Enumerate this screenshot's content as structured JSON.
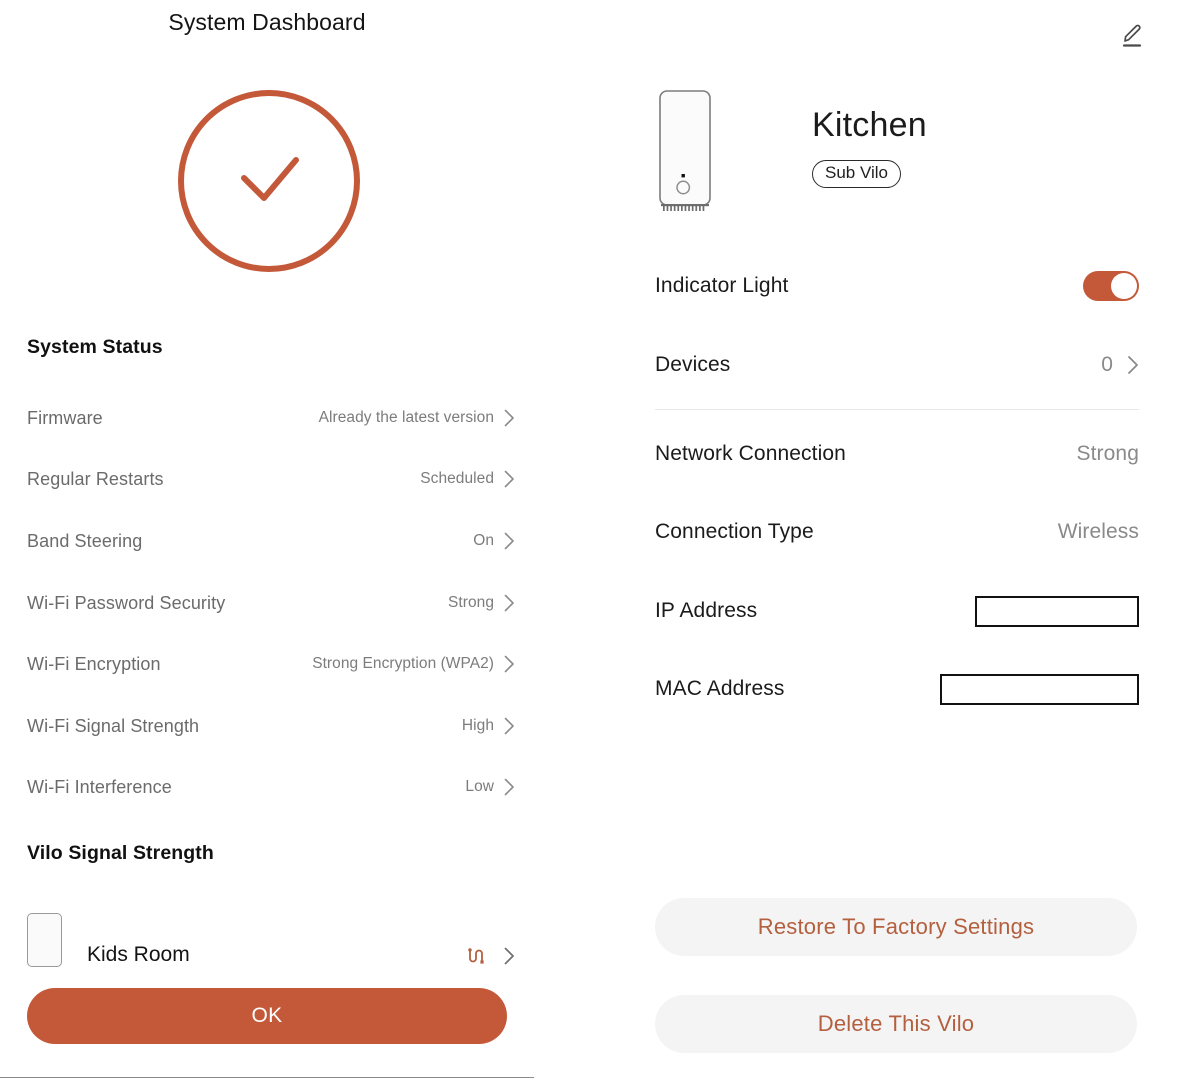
{
  "theme": {
    "accent": "#c4593a",
    "accent_text": "#b4603f",
    "label_gray": "#6b6b6b",
    "value_gray": "#8a8a8a",
    "divider": "#e8e8e8"
  },
  "left": {
    "title": "System Dashboard",
    "status_icon": "check-circle-icon",
    "system_status": {
      "heading": "System Status",
      "rows": [
        {
          "label": "Firmware",
          "value": "Already the latest version"
        },
        {
          "label": "Regular Restarts",
          "value": "Scheduled"
        },
        {
          "label": "Band Steering",
          "value": "On"
        },
        {
          "label": "Wi-Fi Password Security",
          "value": "Strong"
        },
        {
          "label": "Wi-Fi Encryption",
          "value": "Strong Encryption (WPA2)"
        },
        {
          "label": "Wi-Fi Signal Strength",
          "value": "High"
        },
        {
          "label": "Wi-Fi Interference",
          "value": "Low"
        }
      ]
    },
    "vilo_signal": {
      "heading": "Vilo Signal Strength",
      "items": [
        {
          "name": "Kids Room",
          "icon": "mesh-link-icon"
        }
      ]
    },
    "ok_label": "OK"
  },
  "right": {
    "edit_icon": "pencil-edit-icon",
    "device": {
      "name": "Kitchen",
      "badge": "Sub Vilo",
      "image": "vilo-router-icon"
    },
    "indicator_light": {
      "label": "Indicator Light",
      "state": "on"
    },
    "devices": {
      "label": "Devices",
      "value": "0"
    },
    "info_rows": [
      {
        "label": "Network Connection",
        "value": "Strong"
      },
      {
        "label": "Connection Type",
        "value": "Wireless"
      }
    ],
    "redacted_rows": [
      {
        "label": "IP Address",
        "value": ""
      },
      {
        "label": "MAC Address",
        "value": ""
      }
    ],
    "actions": {
      "restore": "Restore To Factory Settings",
      "delete": "Delete This Vilo"
    }
  }
}
